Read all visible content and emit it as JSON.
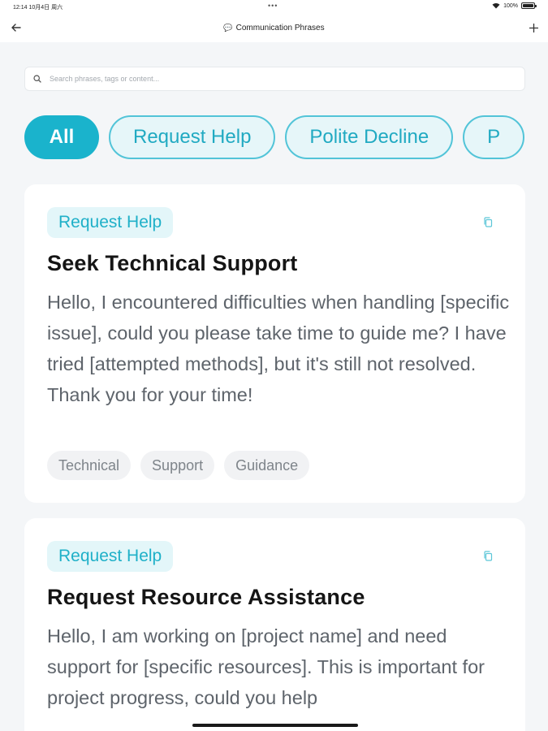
{
  "status_bar": {
    "left_text": "12:14  10月4日 周六",
    "center_dots": "•••",
    "battery_text": "100%"
  },
  "nav": {
    "title": "Communication Phrases",
    "back_icon": "arrow-left-icon",
    "add_icon": "plus-icon",
    "title_icon": "chat-bubble-icon"
  },
  "search": {
    "placeholder": "Search phrases, tags or content...",
    "value": ""
  },
  "filters": [
    {
      "label": "All",
      "active": true
    },
    {
      "label": "Request Help",
      "active": false
    },
    {
      "label": "Polite Decline",
      "active": false
    },
    {
      "label": "P",
      "active": false
    }
  ],
  "cards": [
    {
      "tag": "Request Help",
      "title": "Seek Technical Support",
      "body": "Hello, I encountered difficulties when handling [specific issue], could you please take time to guide me? I have tried [attempted methods], but it's still not resolved. Thank you for your time!",
      "keywords": [
        "Technical",
        "Support",
        "Guidance"
      ]
    },
    {
      "tag": "Request Help",
      "title": "Request Resource Assistance",
      "body": "Hello, I am working on [project name] and need support for [specific resources]. This is important for project progress, could you help"
    }
  ],
  "colors": {
    "accent": "#1ab3cc",
    "chip_bg": "#e6f6f9",
    "tag_bg": "#e3f6f9",
    "background": "#f4f6f8"
  }
}
